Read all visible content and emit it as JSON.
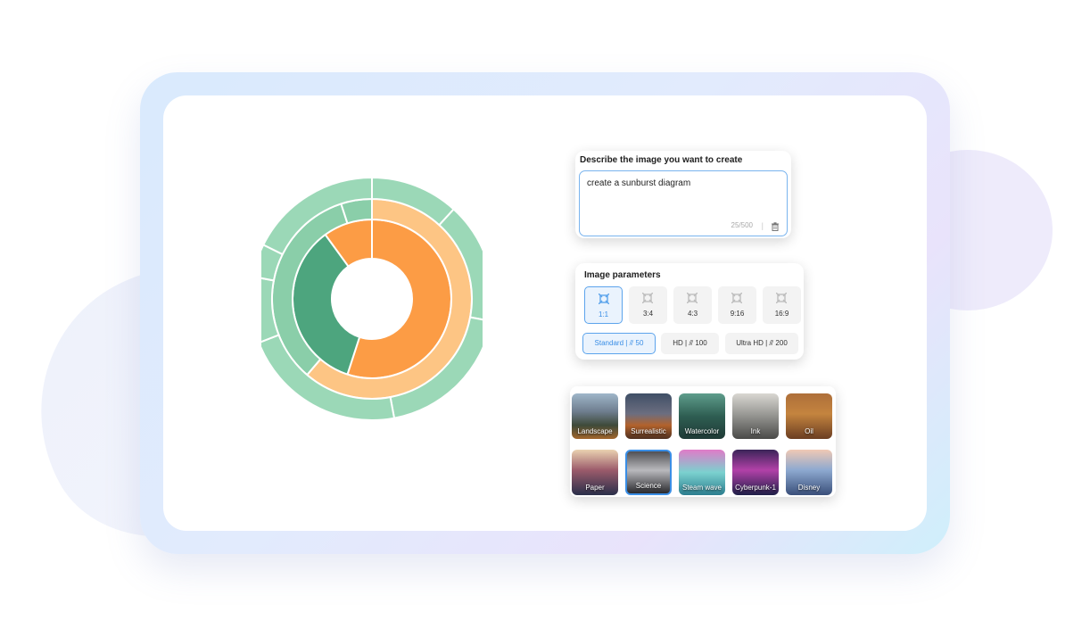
{
  "prompt": {
    "title": "Describe the image you want to create",
    "text": "create a sunburst diagram",
    "count": "25/500",
    "separator": "|",
    "delete_icon": "trash-icon"
  },
  "params": {
    "title": "Image parameters",
    "ratios": [
      {
        "label": "1:1",
        "selected": true
      },
      {
        "label": "3:4",
        "selected": false
      },
      {
        "label": "4:3",
        "selected": false
      },
      {
        "label": "9:16",
        "selected": false
      },
      {
        "label": "16:9",
        "selected": false
      }
    ],
    "ratio_icon": "aspect-ratio-icon",
    "qualities": [
      {
        "label": "Standard | ⫻ 50",
        "selected": true
      },
      {
        "label": "HD | ⫻ 100",
        "selected": false
      },
      {
        "label": "Ultra HD | ⫻ 200",
        "selected": false
      }
    ]
  },
  "styles": [
    {
      "label": "Landscape",
      "selected": false
    },
    {
      "label": "Surrealistic",
      "selected": false
    },
    {
      "label": "Watercolor",
      "selected": false
    },
    {
      "label": "Ink",
      "selected": false
    },
    {
      "label": "Oil",
      "selected": false
    },
    {
      "label": "Paper",
      "selected": false
    },
    {
      "label": "Science",
      "selected": true
    },
    {
      "label": "Steam wave",
      "selected": false
    },
    {
      "label": "Cyberpunk-1",
      "selected": false
    },
    {
      "label": "Disney",
      "selected": false
    }
  ],
  "colors": {
    "inner_dark_green": "#4da57e",
    "inner_orange": "#fc9c45",
    "middle_green": "#8acea9",
    "middle_peach": "#fdc584",
    "outer_green": "#9bd8b7",
    "accent_blue": "#3a8ee6"
  },
  "chart_data": {
    "type": "sunburst",
    "rings": [
      {
        "name": "inner",
        "slices": [
          {
            "value": 44,
            "color": "#fc9c45"
          },
          {
            "value": 28,
            "color": "#4da57e"
          },
          {
            "value": 8,
            "color": "#fc9c45"
          }
        ]
      },
      {
        "name": "middle",
        "slices": [
          {
            "value": 49,
            "color": "#fdc584"
          },
          {
            "value": 27,
            "color": "#8acea9"
          },
          {
            "value": 4,
            "color": "#8acea9"
          }
        ]
      },
      {
        "name": "outer",
        "slices": [
          {
            "value": 8,
            "color": "#9bd8b7"
          },
          {
            "value": 11,
            "color": "#9bd8b7"
          },
          {
            "value": 13,
            "color": "#9bd8b7"
          },
          {
            "value": 15,
            "color": "#9bd8b7"
          },
          {
            "value": 6,
            "color": "#9bd8b7"
          },
          {
            "value": 3,
            "color": "#9bd8b7"
          },
          {
            "value": 12,
            "color": "#9bd8b7"
          }
        ]
      }
    ]
  }
}
